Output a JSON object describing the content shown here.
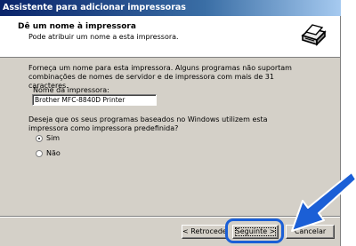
{
  "window": {
    "title": "Assistente para adicionar impressoras"
  },
  "header": {
    "title": "Dê um nome à impressora",
    "subtitle": "Pode atribuir um nome a esta impressora."
  },
  "body": {
    "intro": "Forneça um nome para esta impressora. Alguns programas não suportam combinações de nomes de servidor e de impressora com mais de 31 caracteres.",
    "name_label": "Nome da impressora:",
    "name_value": "Brother MFC-8840D Printer",
    "default_question": "Deseja que os seus programas baseados no Windows utilizem esta impressora como impressora predefinida?",
    "options": [
      {
        "label": "Sim",
        "checked": true
      },
      {
        "label": "Não",
        "checked": false
      }
    ]
  },
  "buttons": {
    "back": "< Retroceder",
    "next": "Seguinte >",
    "cancel": "Cancelar"
  },
  "colors": {
    "highlight": "#1b5fd6",
    "titlebar": "#0a246a"
  },
  "icons": {
    "header": "printer-icon",
    "pointer": "arrow-pointer-icon"
  }
}
